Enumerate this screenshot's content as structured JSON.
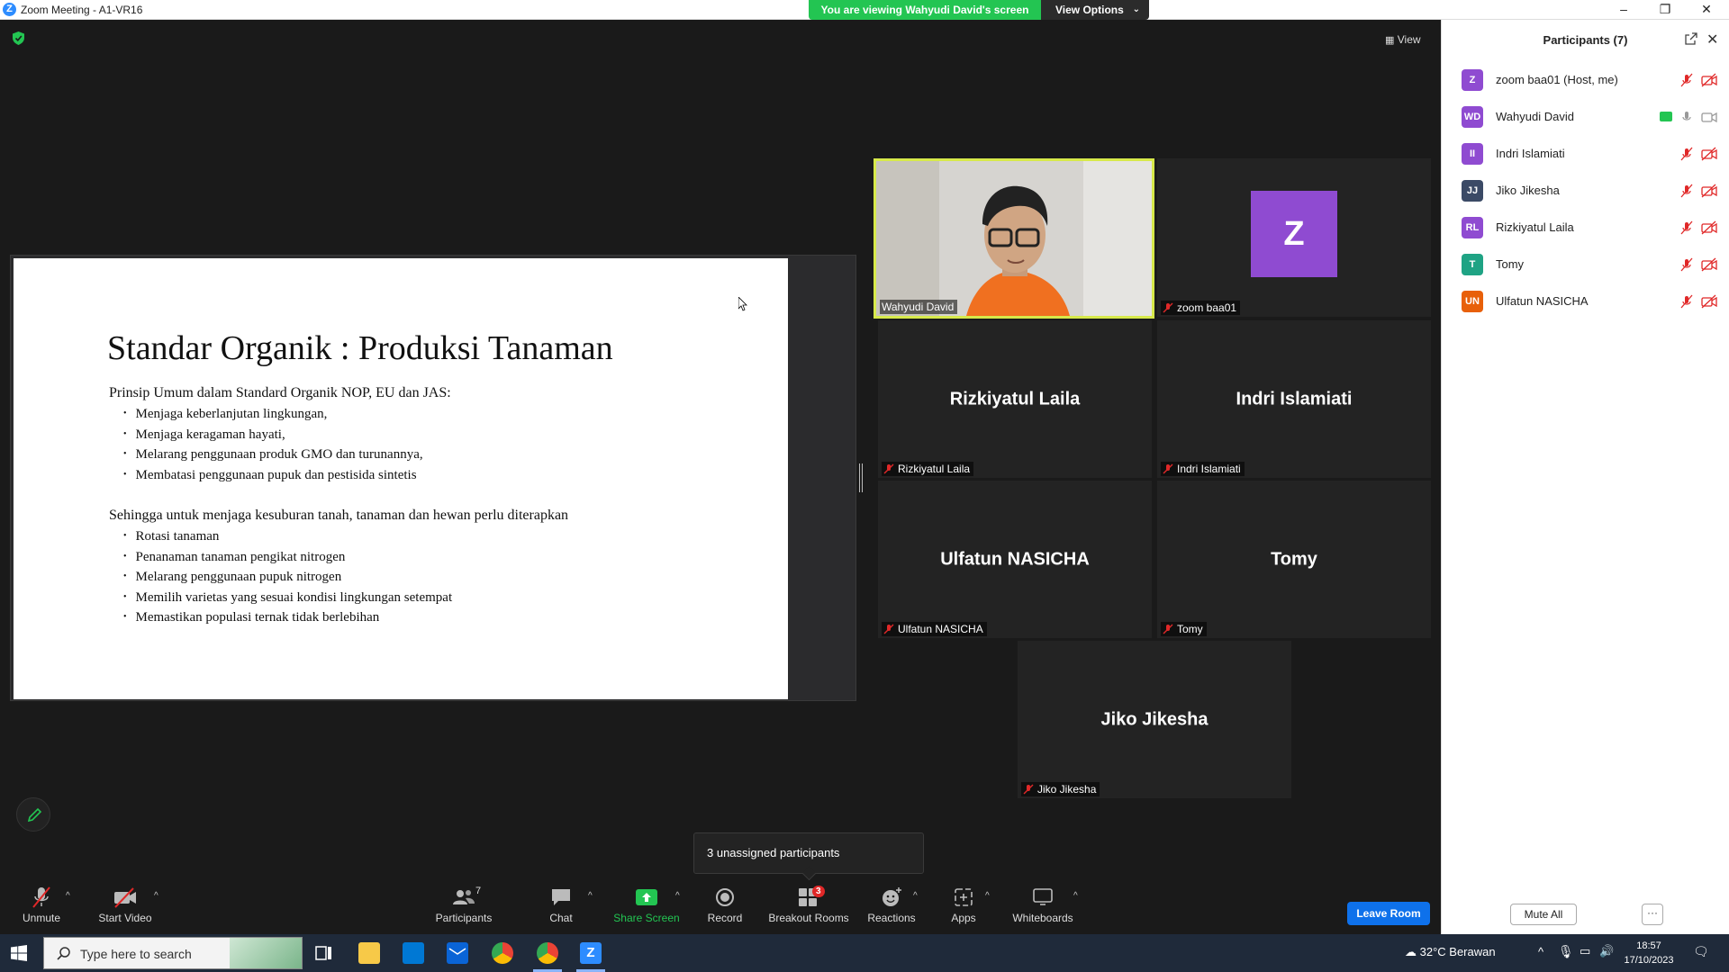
{
  "window": {
    "title": "Zoom Meeting - A1-VR16",
    "viewing_banner": "You are viewing Wahyudi David's screen",
    "view_options": "View Options",
    "view_button": "View"
  },
  "slide": {
    "title": "Standar Organik : Produksi Tanaman",
    "section1_heading": "Prinsip Umum dalam Standard Organik NOP, EU dan JAS:",
    "section1_items": [
      "Menjaga keberlanjutan lingkungan,",
      "Menjaga keragaman hayati,",
      "Melarang penggunaan produk GMO dan turunannya,",
      "Membatasi penggunaan pupuk dan pestisida sintetis"
    ],
    "section2_heading": "Sehingga untuk menjaga kesuburan tanah, tanaman dan hewan perlu diterapkan",
    "section2_items": [
      "Rotasi tanaman",
      "Penanaman tanaman pengikat nitrogen",
      "Melarang penggunaan pupuk nitrogen",
      "Memilih varietas yang sesuai kondisi lingkungan setempat",
      "Memastikan populasi ternak tidak berlebihan"
    ]
  },
  "tiles": {
    "wahyudi": {
      "nametag": "Wahyudi David"
    },
    "zoom": {
      "avatar": "Z",
      "nametag": "zoom baa01"
    },
    "rizkiyatul": {
      "big": "Rizkiyatul Laila",
      "nametag": "Rizkiyatul Laila"
    },
    "indri": {
      "big": "Indri Islamiati",
      "nametag": "Indri Islamiati"
    },
    "ulfatun": {
      "big": "Ulfatun NASICHA",
      "nametag": "Ulfatun NASICHA"
    },
    "tomy": {
      "big": "Tomy",
      "nametag": "Tomy"
    },
    "jiko": {
      "big": "Jiko Jikesha",
      "nametag": "Jiko Jikesha"
    }
  },
  "tooltip": "3 unassigned participants",
  "toolbar": {
    "unmute": "Unmute",
    "start_video": "Start Video",
    "participants": "Participants",
    "participants_count": "7",
    "chat": "Chat",
    "share_screen": "Share Screen",
    "record": "Record",
    "breakout_rooms": "Breakout Rooms",
    "breakout_badge": "3",
    "reactions": "Reactions",
    "apps": "Apps",
    "whiteboards": "Whiteboards",
    "leave_room": "Leave Room"
  },
  "panel": {
    "title": "Participants (7)",
    "participants": [
      {
        "initials": "Z",
        "name": "zoom baa01 (Host, me)",
        "color": "#8f4bd1"
      },
      {
        "initials": "WD",
        "name": "Wahyudi David",
        "color": "#8f4bd1"
      },
      {
        "initials": "II",
        "name": "Indri Islamiati",
        "color": "#8f4bd1"
      },
      {
        "initials": "JJ",
        "name": "Jiko Jikesha",
        "color": "#3b4a66"
      },
      {
        "initials": "RL",
        "name": "Rizkiyatul Laila",
        "color": "#8f4bd1"
      },
      {
        "initials": "T",
        "name": "Tomy",
        "color": "#1fa384"
      },
      {
        "initials": "UN",
        "name": "Ulfatun NASICHA",
        "color": "#e8600a"
      }
    ],
    "mute_all": "Mute All",
    "more": "···"
  },
  "taskbar": {
    "search_placeholder": "Type here to search",
    "weather": "32°C  Berawan",
    "time": "18:57",
    "date": "17/10/2023"
  },
  "colors": {
    "accent_blue": "#0e71eb",
    "share_green": "#23c552",
    "speaker_border": "#d7e94a",
    "mute_red": "#e02828"
  }
}
